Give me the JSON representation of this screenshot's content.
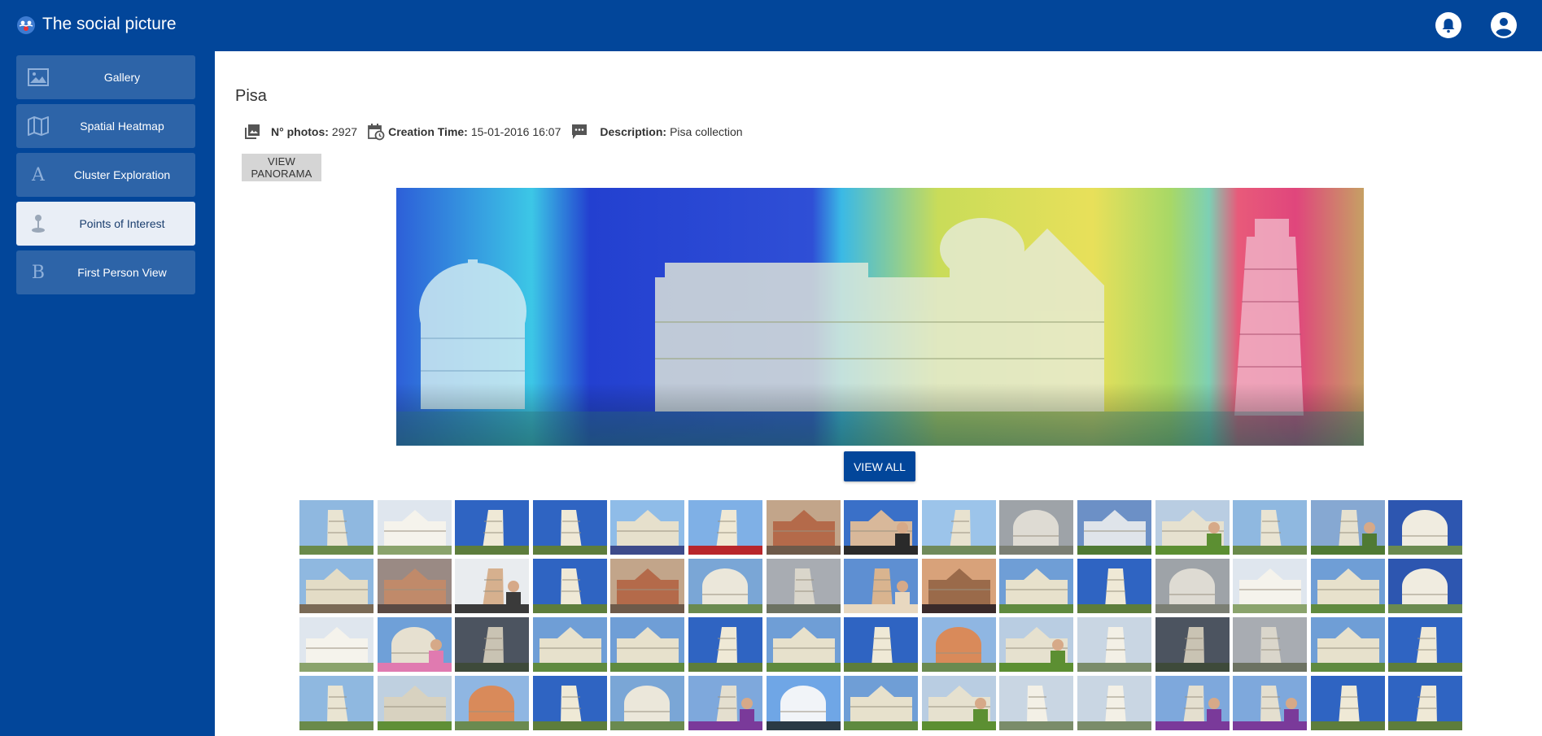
{
  "app": {
    "title": "The social picture"
  },
  "header": {
    "icons": [
      "notifications-icon",
      "account-icon"
    ]
  },
  "sidebar": {
    "items": [
      {
        "label": "Gallery",
        "icon": "image-icon",
        "active": false
      },
      {
        "label": "Spatial Heatmap",
        "icon": "map-icon",
        "active": false
      },
      {
        "label": "Cluster Exploration",
        "icon": "letter-a-icon",
        "glyph": "A",
        "active": false
      },
      {
        "label": "Points of Interest",
        "icon": "pin-icon",
        "active": true
      },
      {
        "label": "First Person View",
        "icon": "letter-b-icon",
        "glyph": "B",
        "active": false
      }
    ]
  },
  "collection": {
    "title": "Pisa",
    "photos_label": "N° photos:",
    "photos_value": "2927",
    "creation_label": "Creation Time:",
    "creation_value": "15-01-2016 16:07",
    "description_label": "Description:",
    "description_value": "Pisa collection"
  },
  "buttons": {
    "view_panorama": "VIEW PANORAMA",
    "view_all": "VIEW ALL"
  },
  "colors": {
    "brand": "#02469a",
    "nav_item": "#2d64a8",
    "nav_active": "#e9eef6"
  },
  "thumbnails": [
    "tower",
    "cathedral-white",
    "tower-blue",
    "tower-blue",
    "crowd",
    "tower-car",
    "street",
    "selfie",
    "tower-duomo",
    "baptistery-grey",
    "panel",
    "person-lawn",
    "tower",
    "tower-person",
    "baptistery-blue",
    "square",
    "rooftops",
    "man-tower",
    "tower-blue",
    "street",
    "baptistery",
    "tower-grey",
    "woman-tower",
    "sunset",
    "cathedral",
    "tower-blue",
    "baptistery-grey",
    "cathedral-white",
    "cathedral",
    "baptistery-blue",
    "cathedral-white",
    "woman-baptistery",
    "tower-dark",
    "cathedral",
    "cathedral",
    "tower-blue",
    "cathedral",
    "tower-blue",
    "baptistery-red",
    "person-lawn",
    "tower-white",
    "tower-dark",
    "tower-grey",
    "cathedral",
    "tower-blue",
    "tower",
    "lawn",
    "baptistery-red",
    "tower-blue",
    "baptistery",
    "person-tower",
    "dome-sky",
    "cathedral",
    "person-lawn",
    "tower-white",
    "tower-white",
    "person-tower",
    "person-tower",
    "tower-blue",
    "tower-blue"
  ]
}
